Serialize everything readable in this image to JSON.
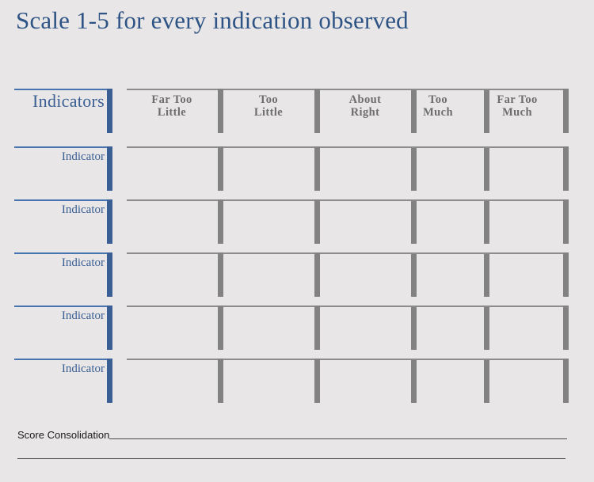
{
  "page": {
    "title": "Scale 1-5 for every indication observed",
    "background_color": "#e8e6e6",
    "accent_blue": "#3a5f94",
    "accent_gray": "#828282"
  },
  "matrix": {
    "row_header_label": "Indicators",
    "columns": [
      {
        "label": "Far Too Little",
        "line1": "Far Too",
        "line2": "Little"
      },
      {
        "label": "Too Little",
        "line1": "Too",
        "line2": "Little"
      },
      {
        "label": "About Right",
        "line1": "About",
        "line2": "Right"
      },
      {
        "label": "Too Much",
        "line1": "Too",
        "line2": "Much"
      },
      {
        "label": "Far Too Much",
        "line1": "Far Too",
        "line2": "Much"
      }
    ],
    "rows": [
      {
        "label": "Indicator"
      },
      {
        "label": "Indicator"
      },
      {
        "label": "Indicator"
      },
      {
        "label": "Indicator"
      },
      {
        "label": "Indicator"
      }
    ]
  },
  "footer": {
    "score_label": "Score Consolidation",
    "score_value": "",
    "blank_value": ""
  }
}
